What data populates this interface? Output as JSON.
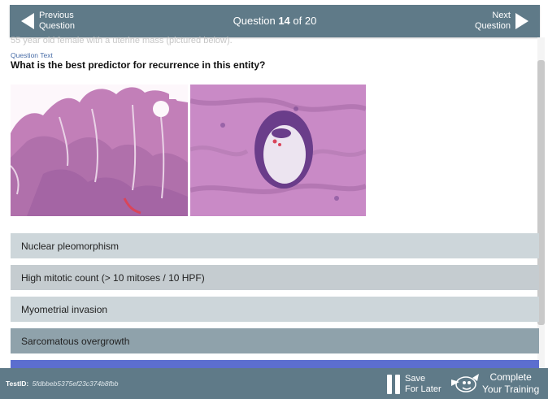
{
  "header": {
    "prev_label_1": "Previous",
    "prev_label_2": "Question",
    "next_label_1": "Next",
    "next_label_2": "Question",
    "question_prefix": "Question ",
    "question_number": "14",
    "question_suffix": " of 20"
  },
  "stem_text": "55 year old female with a uterine mass (pictured below).",
  "question_text_label": "Question Text",
  "question": "What is the best predictor for recurrence in this entity?",
  "answers": [
    "Nuclear pleomorphism",
    "High mitotic count (> 10 mitoses / 10 HPF)",
    "Myometrial invasion",
    "Sarcomatous overgrowth"
  ],
  "footer": {
    "test_id_label": "TestID:",
    "test_id_value": "5fdbbeb5375ef23c374b8fbb",
    "save_label_1": "Save",
    "save_label_2": "For Later",
    "complete_label_1": "Complete",
    "complete_label_2": "Your Training"
  },
  "colors": {
    "bar": "#5f7a88",
    "answer_light": "#cdd6da",
    "answer_selected": "#8fa2ab",
    "answer_accent": "#5c6ecf",
    "question_label": "#4a6ea8"
  },
  "icons": [
    "chevron-left-icon",
    "chevron-right-icon",
    "pause-icon",
    "mascot-logo-icon"
  ]
}
